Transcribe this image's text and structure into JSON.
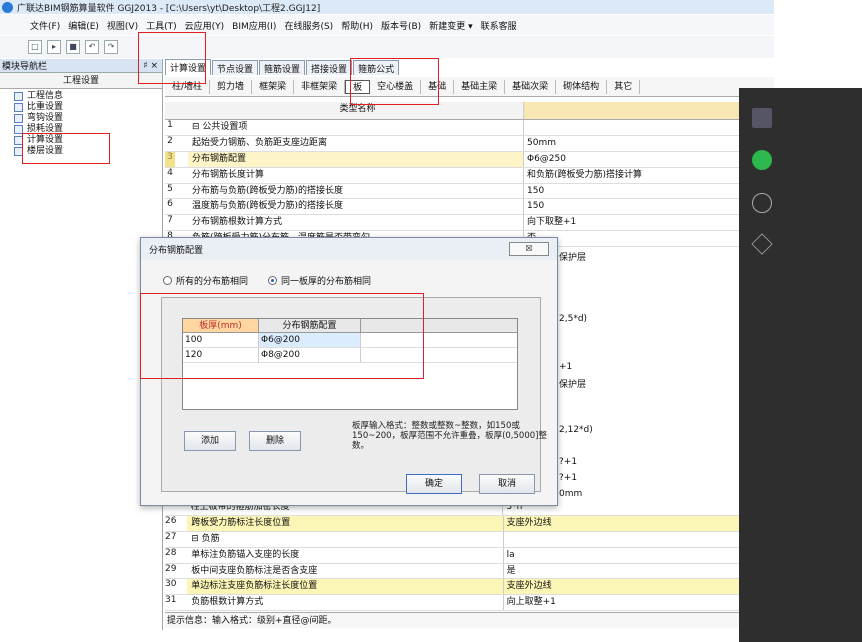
{
  "window": {
    "title": "广联达BIM钢筋算量软件 GGJ2013 - [C:\\Users\\yt\\Desktop\\工程2.GGJ12]"
  },
  "menu": [
    "文件(F)",
    "编辑(E)",
    "视图(V)",
    "工具(T)",
    "云应用(Y)",
    "BIM应用(I)",
    "在线服务(S)",
    "帮助(H)",
    "版本号(B)",
    "新建变更 ▾",
    "联系客服"
  ],
  "nav": {
    "header": "模块导航栏",
    "pin": "♯ ×",
    "section": "工程设置",
    "items": [
      "工程信息",
      "比重设置",
      "弯钩设置",
      "损耗设置",
      "计算设置",
      "楼层设置"
    ]
  },
  "tabs": [
    "计算设置",
    "节点设置",
    "箍筋设置",
    "搭接设置",
    "箍筋公式"
  ],
  "subtabs": [
    "柱/墙柱",
    "剪力墙",
    "框架梁",
    "非框架梁",
    "板",
    "空心楼盖",
    "基础",
    "基础主梁",
    "基础次梁",
    "砌体结构",
    "其它"
  ],
  "grid": {
    "header": "类型名称",
    "rows": [
      {
        "no": "1",
        "name": "⊟ 公共设置项",
        "value": ""
      },
      {
        "no": "2",
        "name": "起始受力钢筋、负筋距支座边距离",
        "value": "50mm"
      },
      {
        "no": "3",
        "name": "分布钢筋配置",
        "value": "Φ6@250"
      },
      {
        "no": "4",
        "name": "分布钢筋长度计算",
        "value": "和负筋(跨板受力筋)搭接计算"
      },
      {
        "no": "5",
        "name": "分布筋与负筋(跨板受力筋)的搭接长度",
        "value": "150"
      },
      {
        "no": "6",
        "name": "温度筋与负筋(跨板受力筋)的搭接长度",
        "value": "150"
      },
      {
        "no": "7",
        "name": "分布钢筋根数计算方式",
        "value": "向下取整+1"
      },
      {
        "no": "8",
        "name": "负筋(跨板受力筋)分布筋、温度筋是否带弯勾",
        "value": "否"
      }
    ],
    "partial_values": [
      "保护层",
      "2,5*d)",
      "+1",
      "保护层",
      "2,12*d)",
      "?+1",
      "?+1",
      "0mm"
    ],
    "rows_bottom": [
      {
        "no": "",
        "name": "柱上板带的箍筋加密长度",
        "value": "3*h"
      },
      {
        "no": "26",
        "name": "跨板受力筋标注长度位置",
        "value": "支座外边线"
      },
      {
        "no": "27",
        "name": "⊟ 负筋",
        "value": ""
      },
      {
        "no": "28",
        "name": "单标注负筋锚入支座的长度",
        "value": "la"
      },
      {
        "no": "29",
        "name": "板中间支座负筋标注是否含支座",
        "value": "是"
      },
      {
        "no": "30",
        "name": "单边标注支座负筋标注长度位置",
        "value": "支座外边线"
      },
      {
        "no": "31",
        "name": "负筋根数计算方式",
        "value": "向上取整+1"
      }
    ]
  },
  "status": "提示信息：输入格式：级别+直径@间距。",
  "dialog": {
    "title": "分布钢筋配置",
    "close": "☒",
    "radio1": "所有的分布筋相同",
    "radio2": "同一板厚的分布筋相同",
    "col1": "板厚(mm)",
    "col2": "分布钢筋配置",
    "rows": [
      {
        "thick": "100",
        "config": "Φ6@200"
      },
      {
        "thick": "120",
        "config": "Φ8@200"
      }
    ],
    "add": "添加",
    "delete": "删除",
    "hint": "板厚输入格式：整数或整数~整数，如150或150~200，板厚范围不允许重叠，板厚(0,5000]整数。",
    "ok": "确定",
    "cancel": "取消"
  },
  "colors": {
    "highlight": "#e02020",
    "selection": "#f5e18a",
    "dark_panel": "#2e2e2e",
    "wechat_green": "#2db84d"
  }
}
